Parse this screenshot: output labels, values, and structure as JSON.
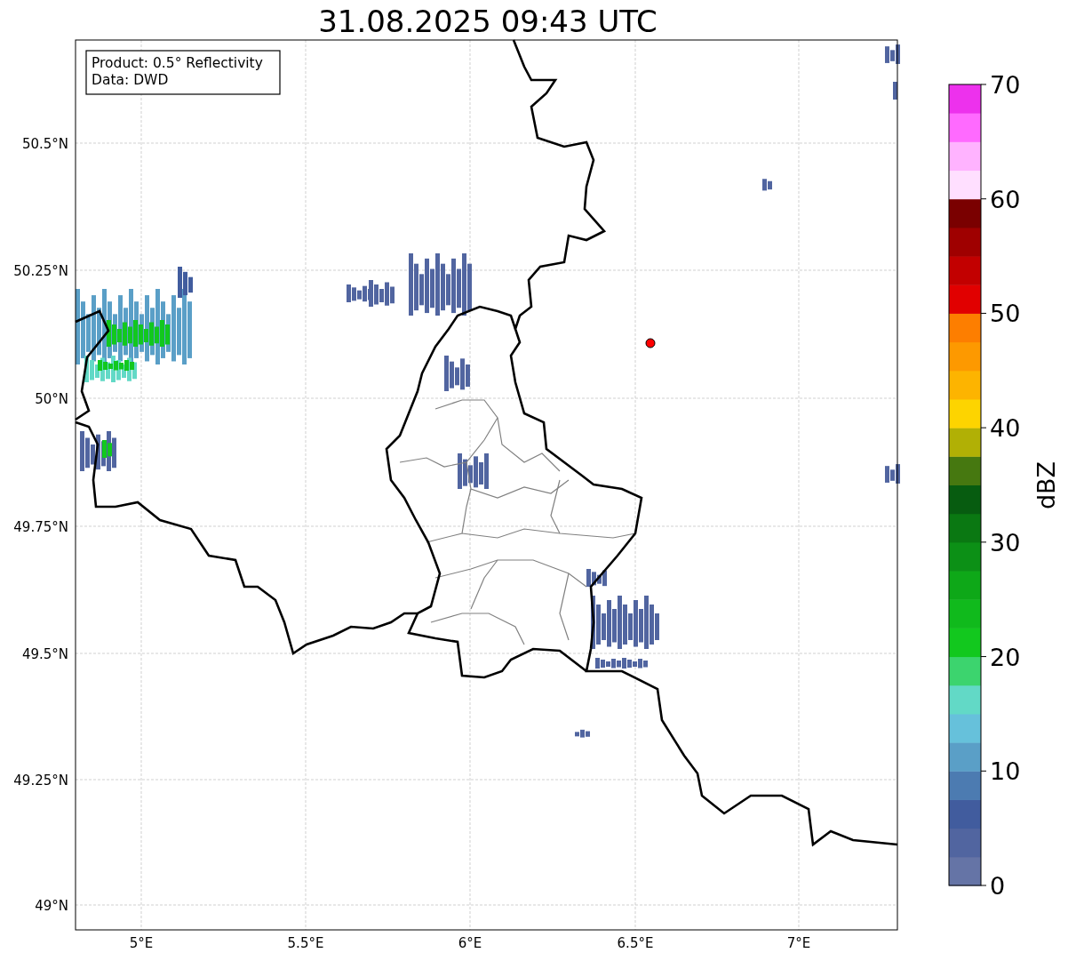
{
  "title": "31.08.2025 09:43 UTC",
  "map": {
    "info_box": [
      "Product: 0.5° Reflectivity",
      "Data: DWD"
    ],
    "lat_ticks": [
      "50.5°N",
      "50.25°N",
      "50°N",
      "49.75°N",
      "49.5°N",
      "49.25°N",
      "49°N"
    ],
    "lon_ticks": [
      "5°E",
      "5.5°E",
      "6°E",
      "6.5°E",
      "7°E"
    ]
  },
  "colorbar": {
    "label": "dBZ",
    "ticks": [
      "70",
      "60",
      "50",
      "40",
      "30",
      "20",
      "10",
      "0"
    ],
    "bins": [
      {
        "color": "#6574a6"
      },
      {
        "color": "#5165a0"
      },
      {
        "color": "#415c9e"
      },
      {
        "color": "#4c7bb1"
      },
      {
        "color": "#5a9fc7"
      },
      {
        "color": "#66c1db"
      },
      {
        "color": "#62d9c6"
      },
      {
        "color": "#3cd46e"
      },
      {
        "color": "#12c81e"
      },
      {
        "color": "#10ba1c"
      },
      {
        "color": "#0ea818"
      },
      {
        "color": "#0c9016"
      },
      {
        "color": "#0a7812"
      },
      {
        "color": "#075c10"
      },
      {
        "color": "#467810"
      },
      {
        "color": "#b1b005"
      },
      {
        "color": "#fdd400"
      },
      {
        "color": "#fdb400"
      },
      {
        "color": "#fd9900"
      },
      {
        "color": "#fd7e00"
      },
      {
        "color": "#e10000"
      },
      {
        "color": "#c20000"
      },
      {
        "color": "#9f0000"
      },
      {
        "color": "#7a0000"
      },
      {
        "color": "#ffdfff"
      },
      {
        "color": "#ffb3ff"
      },
      {
        "color": "#ff6aff"
      },
      {
        "color": "#ed31ed"
      }
    ]
  }
}
